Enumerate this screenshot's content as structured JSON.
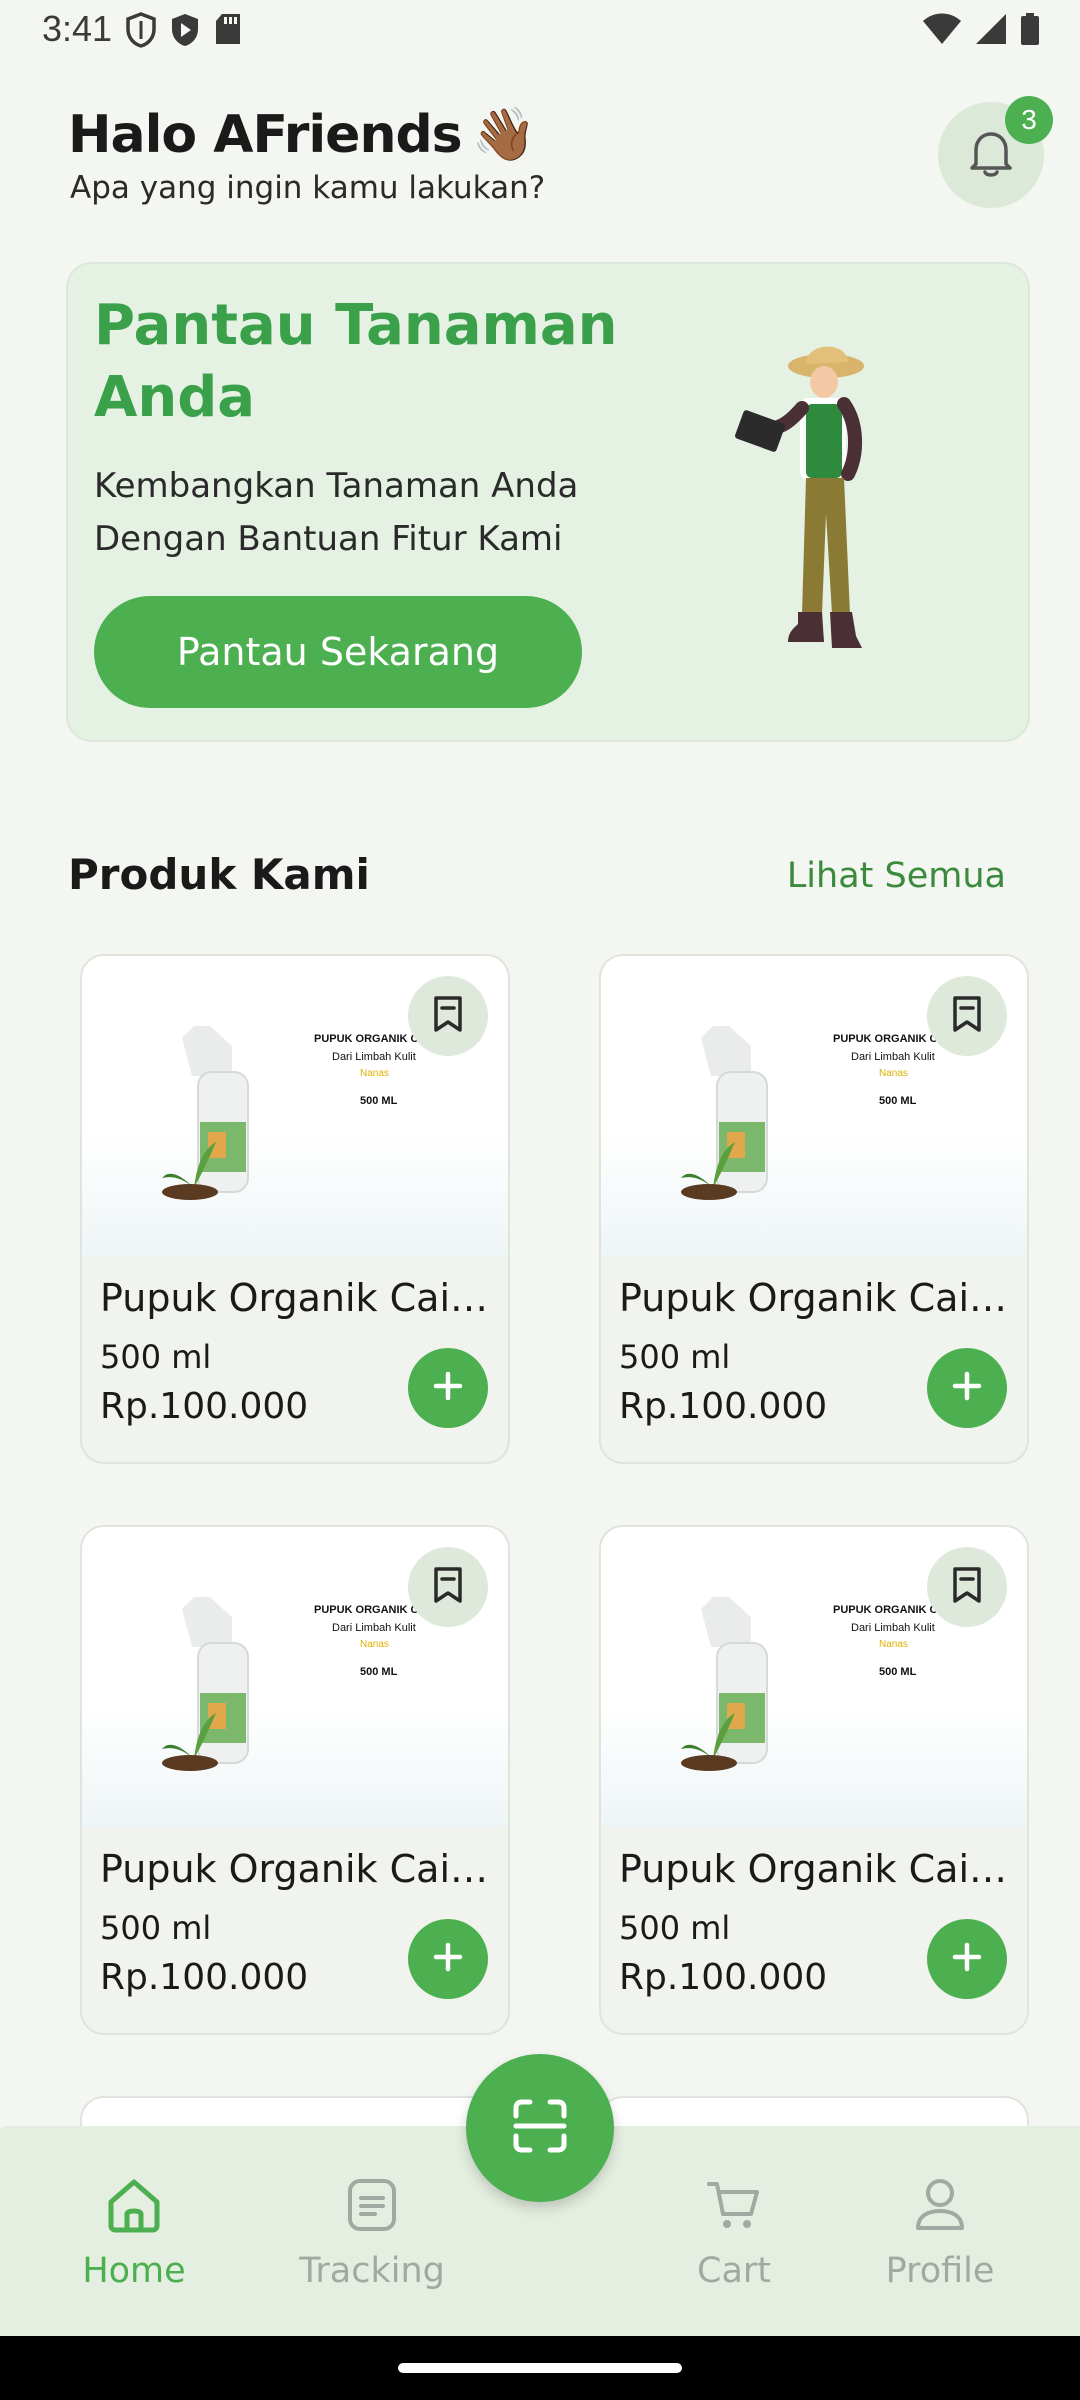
{
  "status": {
    "time": "3:41"
  },
  "header": {
    "greeting": "Halo AFriends",
    "wave_emoji": "👋🏾",
    "subtitle": "Apa yang ingin kamu lakukan?",
    "notification_count": "3"
  },
  "banner": {
    "title": "Pantau Tanaman Anda",
    "description": "Kembangkan Tanaman Anda Dengan Bantuan Fitur Kami",
    "button_label": "Pantau Sekarang"
  },
  "products_section": {
    "title": "Produk Kami",
    "see_all": "Lihat Semua"
  },
  "products": [
    {
      "name": "Pupuk Organik Cair Dari Limbah Kulit Nanas",
      "size": "500 ml",
      "price": "Rp.100.000",
      "label_line1": "PUPUK ORGANIK CAIR",
      "label_line2": "Dari Limbah Kulit",
      "label_line3": "Nanas",
      "label_line4": "500 ML"
    },
    {
      "name": "Pupuk Organik Cair Dari Limbah Kulit Nanas",
      "size": "500 ml",
      "price": "Rp.100.000",
      "label_line1": "PUPUK ORGANIK CAIR",
      "label_line2": "Dari Limbah Kulit",
      "label_line3": "Nanas",
      "label_line4": "500 ML"
    },
    {
      "name": "Pupuk Organik Cair Dari Limbah Kulit Nanas",
      "size": "500 ml",
      "price": "Rp.100.000",
      "label_line1": "PUPUK ORGANIK CAIR",
      "label_line2": "Dari Limbah Kulit",
      "label_line3": "Nanas",
      "label_line4": "500 ML"
    },
    {
      "name": "Pupuk Organik Cair Dari Limbah Kulit Nanas",
      "size": "500 ml",
      "price": "Rp.100.000",
      "label_line1": "PUPUK ORGANIK CAIR",
      "label_line2": "Dari Limbah Kulit",
      "label_line3": "Nanas",
      "label_line4": "500 ML"
    }
  ],
  "bottom_nav": {
    "home": "Home",
    "tracking": "Tracking",
    "cart": "Cart",
    "profile": "Profile",
    "active": "home"
  },
  "colors": {
    "accent": "#4caf50",
    "banner_bg": "#e4f1e3",
    "nav_bg": "#e5efe1",
    "inactive": "#a4a8a3"
  }
}
